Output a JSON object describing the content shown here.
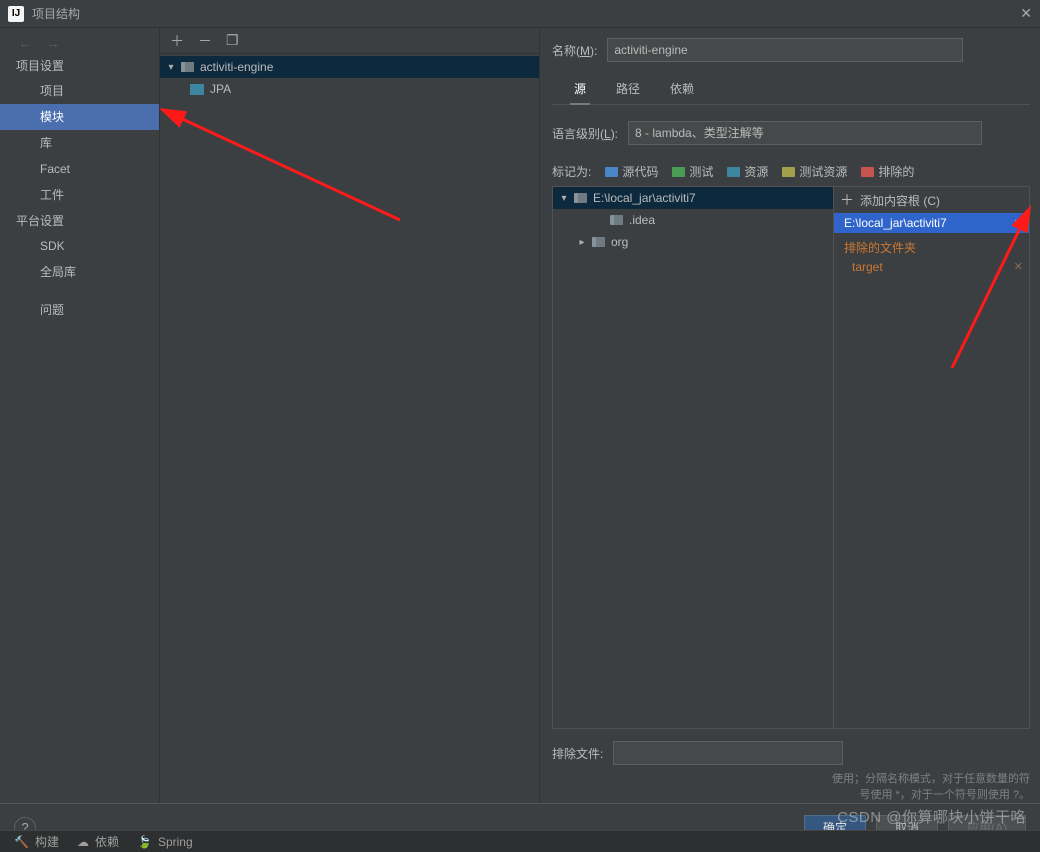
{
  "window": {
    "title": "项目结构"
  },
  "sidebar": {
    "section_project": "项目设置",
    "items_project": [
      {
        "label": "项目"
      },
      {
        "label": "模块",
        "selected": true
      },
      {
        "label": "库"
      },
      {
        "label": "Facet"
      },
      {
        "label": "工件"
      }
    ],
    "section_platform": "平台设置",
    "items_platform": [
      {
        "label": "SDK"
      },
      {
        "label": "全局库"
      }
    ],
    "section_issues": "问题"
  },
  "mid": {
    "items": [
      {
        "label": "activiti-engine",
        "selected": true,
        "expanded": true,
        "children": [
          {
            "label": "JPA"
          }
        ]
      }
    ]
  },
  "right": {
    "name_label": "名称(M):",
    "name_value": "activiti-engine",
    "tabs": [
      {
        "label": "源",
        "active": true
      },
      {
        "label": "路径"
      },
      {
        "label": "依赖"
      }
    ],
    "lang_label": "语言级别(L):",
    "lang_value": "8 - lambda、类型注解等",
    "mark_label": "标记为:",
    "marks": [
      {
        "label": "源代码",
        "color": "#4a86c5"
      },
      {
        "label": "测试",
        "color": "#499c54"
      },
      {
        "label": "资源",
        "color": "#3e86a0"
      },
      {
        "label": "测试资源",
        "color": "#a1a14a"
      },
      {
        "label": "排除的",
        "color": "#c75450"
      }
    ],
    "content_root": "E:\\local_jar\\activiti7",
    "folders": [
      {
        "label": ".idea"
      },
      {
        "label": "org",
        "hasChildren": true
      }
    ],
    "add_root_label": "添加内容根 (C)",
    "selected_root": "E:\\local_jar\\activiti7",
    "excluded_label": "排除的文件夹",
    "excluded_items": [
      {
        "label": "target"
      }
    ],
    "exclude_files_label": "排除文件:",
    "exclude_hint1": "使用；分隔名称模式，对于任意数量的符",
    "exclude_hint2": "号使用 *，对于一个符号则使用 ?。"
  },
  "footer": {
    "ok": "确定",
    "cancel": "取消",
    "apply": "应用(A)"
  },
  "bottom": {
    "build": "构建",
    "deps": "依赖",
    "spring": "Spring"
  },
  "watermark": "CSDN @你算哪块小饼干咯"
}
